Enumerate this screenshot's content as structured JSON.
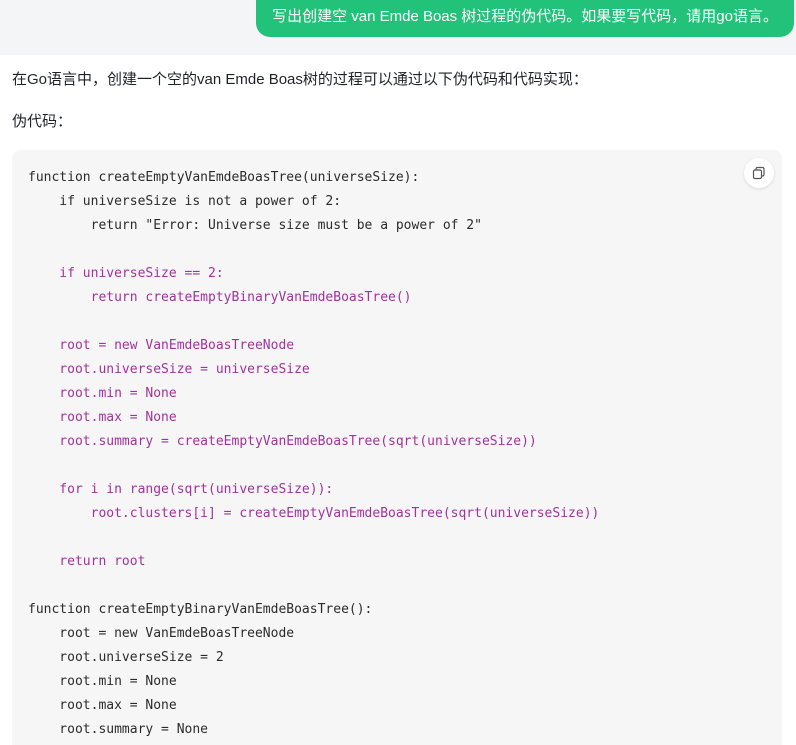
{
  "user_message": {
    "text": "写出创建空 van Emde Boas 树过程的伪代码。如果要写代码，请用go语言。"
  },
  "answer": {
    "intro": "在Go语言中，创建一个空的van Emde Boas树的过程可以通过以下伪代码和代码实现：",
    "section_label": "伪代码：",
    "copy_icon": "copy-icon",
    "code_lines": [
      {
        "text": "function createEmptyVanEmdeBoasTree(universeSize):",
        "style": "plain"
      },
      {
        "text": "    if universeSize is not a power of 2:",
        "style": "plain"
      },
      {
        "text": "        return \"Error: Universe size must be a power of 2\"",
        "style": "plain"
      },
      {
        "text": "",
        "style": "plain"
      },
      {
        "text": "    if universeSize == 2:",
        "style": "kw"
      },
      {
        "text": "        return createEmptyBinaryVanEmdeBoasTree()",
        "style": "kw"
      },
      {
        "text": "",
        "style": "plain"
      },
      {
        "text": "    root = new VanEmdeBoasTreeNode",
        "style": "kw"
      },
      {
        "text": "    root.universeSize = universeSize",
        "style": "kw"
      },
      {
        "text": "    root.min = None",
        "style": "kw"
      },
      {
        "text": "    root.max = None",
        "style": "kw"
      },
      {
        "text": "    root.summary = createEmptyVanEmdeBoasTree(sqrt(universeSize))",
        "style": "kw"
      },
      {
        "text": "",
        "style": "plain"
      },
      {
        "text": "    for i in range(sqrt(universeSize)):",
        "style": "kw"
      },
      {
        "text": "        root.clusters[i] = createEmptyVanEmdeBoasTree(sqrt(universeSize))",
        "style": "kw"
      },
      {
        "text": "",
        "style": "plain"
      },
      {
        "text": "    return root",
        "style": "kw"
      },
      {
        "text": "",
        "style": "plain"
      },
      {
        "text": "function createEmptyBinaryVanEmdeBoasTree():",
        "style": "plain"
      },
      {
        "text": "    root = new VanEmdeBoasTreeNode",
        "style": "plain"
      },
      {
        "text": "    root.universeSize = 2",
        "style": "plain"
      },
      {
        "text": "    root.min = None",
        "style": "plain"
      },
      {
        "text": "    root.max = None",
        "style": "plain"
      },
      {
        "text": "    root.summary = None",
        "style": "plain"
      }
    ]
  },
  "colors": {
    "user_bubble": "#22c27a",
    "code_background": "#f6f6f7",
    "code_plain": "#2b2b2b",
    "code_highlight": "#a3329b"
  }
}
